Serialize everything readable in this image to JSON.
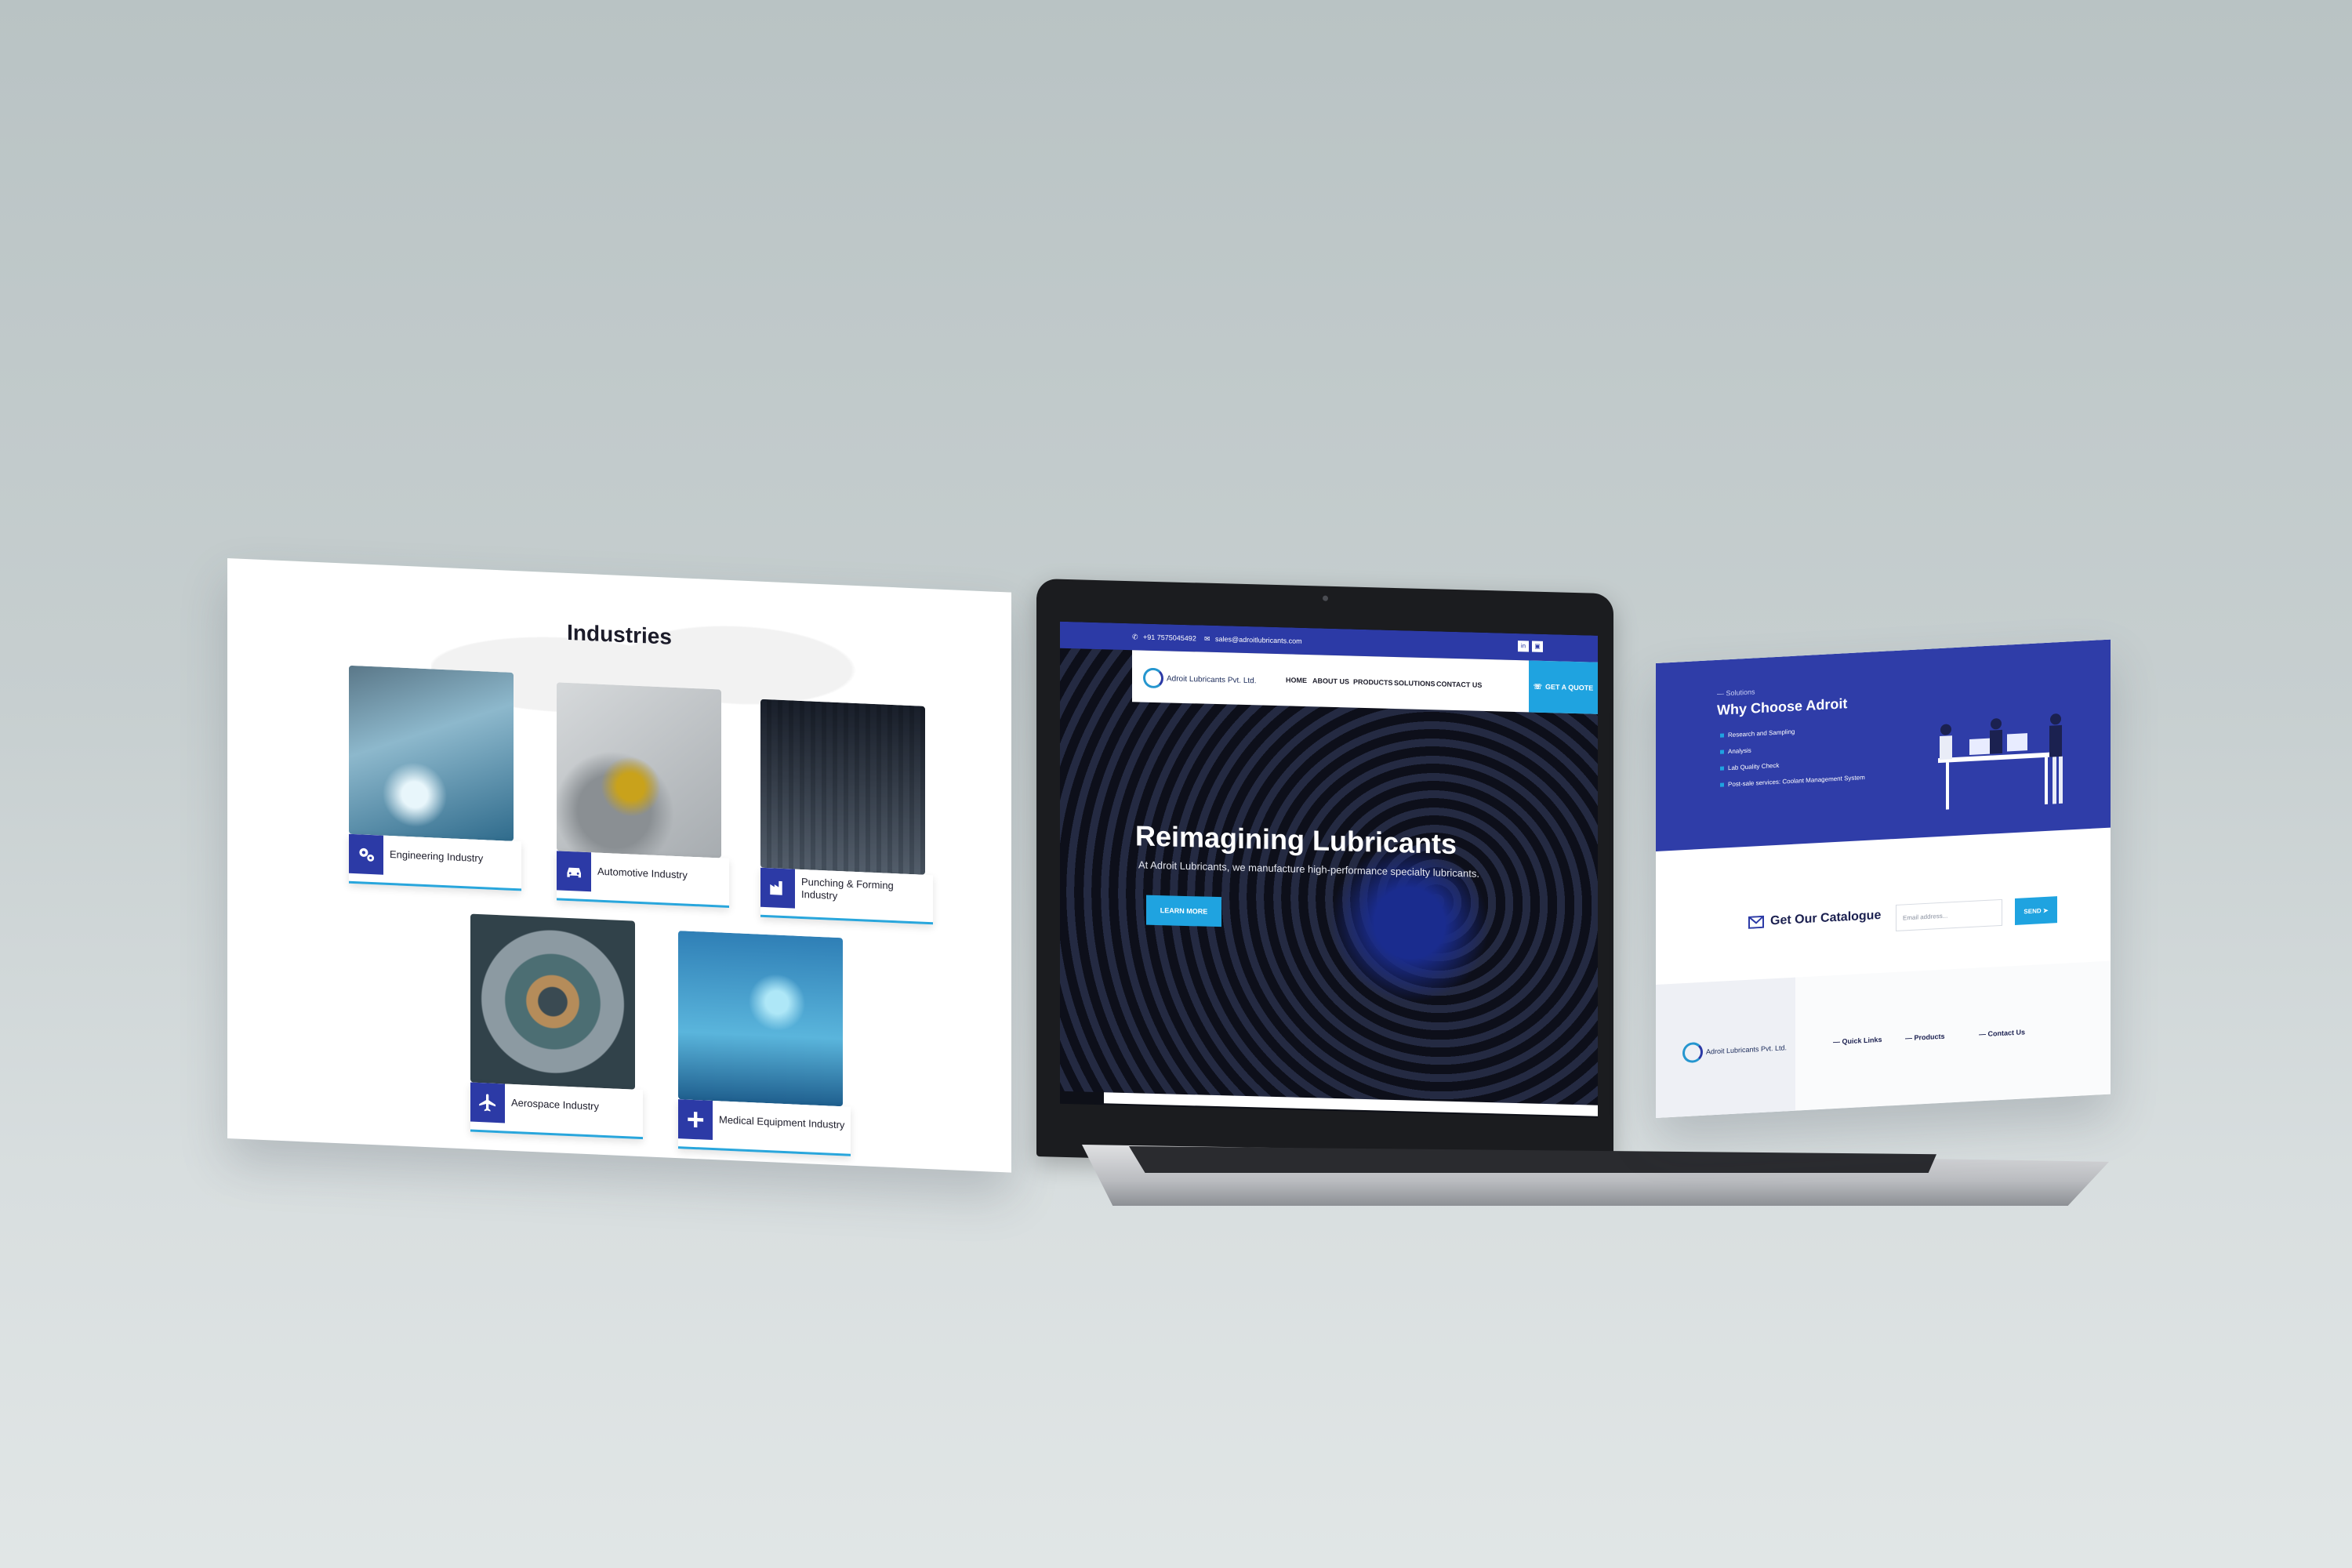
{
  "industries": {
    "title": "Industries",
    "cards": [
      {
        "label": "Engineering Industry",
        "icon": "gears-icon"
      },
      {
        "label": "Automotive Industry",
        "icon": "car-icon"
      },
      {
        "label": "Punching & Forming Industry",
        "icon": "factory-icon"
      },
      {
        "label": "Aerospace Industry",
        "icon": "airplane-icon"
      },
      {
        "label": "Medical Equipment Industry",
        "icon": "plus-icon"
      }
    ]
  },
  "site": {
    "topbar": {
      "phone": "+91 7575045492",
      "email": "sales@adroitlubricants.com",
      "social": [
        "in",
        "▣"
      ]
    },
    "brand": "Adroit Lubricants Pvt. Ltd.",
    "nav": [
      "HOME",
      "ABOUT US",
      "PRODUCTS",
      "SOLUTIONS",
      "CONTACT US"
    ],
    "quote_button": "GET A QUOTE",
    "hero": {
      "title": "Reimagining Lubricants",
      "subtitle": "At Adroit Lubricants, we manufacture high-performance specialty lubricants.",
      "button": "LEARN MORE"
    }
  },
  "why": {
    "crumb": "— Solutions",
    "title": "Why Choose Adroit",
    "items": [
      "Research and Sampling",
      "Analysis",
      "Lab Quality Check",
      "Post-sale services: Coolant Management System"
    ],
    "catalogue_title": "Get Our Catalogue",
    "email_placeholder": "Email address...",
    "send_label": "SEND ➤",
    "footer_brand": "Adroit Lubricants Pvt. Ltd.",
    "footer_cols": [
      "— Quick Links",
      "— Products",
      "— Contact Us"
    ]
  },
  "colors": {
    "brand_blue": "#2c3aa6",
    "accent_cyan": "#1fa3e0"
  }
}
